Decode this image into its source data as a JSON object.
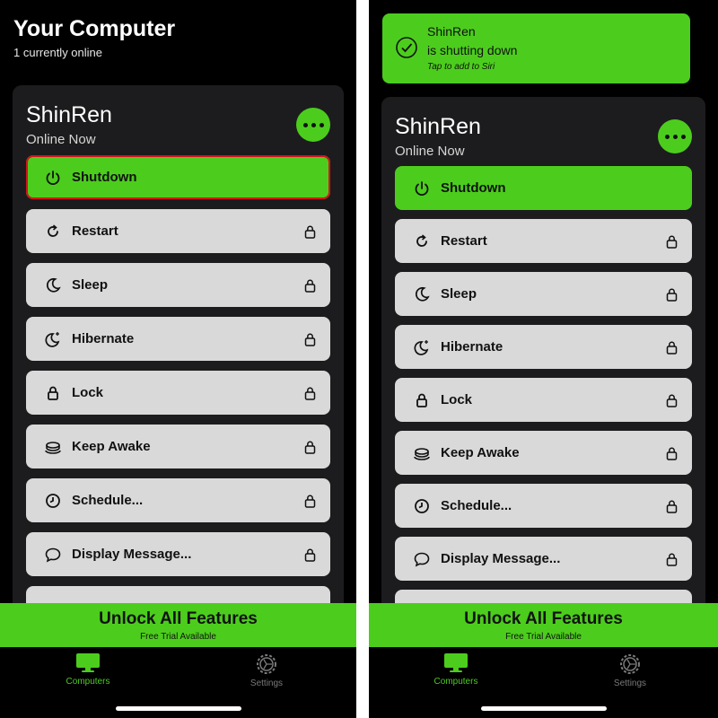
{
  "colors": {
    "accent": "#4ccd1d",
    "row_bg": "#d9d9d9",
    "card_bg": "#1c1c1e",
    "highlight_border": "#d4141a"
  },
  "left": {
    "title": "Your Computer",
    "subtitle": "1 currently online",
    "computer": {
      "name": "ShinRen",
      "status": "Online Now"
    },
    "actions": [
      {
        "label": "Shutdown",
        "icon": "power-icon",
        "locked": false,
        "primary": true,
        "highlighted": true
      },
      {
        "label": "Restart",
        "icon": "restart-icon",
        "locked": true
      },
      {
        "label": "Sleep",
        "icon": "moon-icon",
        "locked": true
      },
      {
        "label": "Hibernate",
        "icon": "moon-stars-icon",
        "locked": true
      },
      {
        "label": "Lock",
        "icon": "lock-icon",
        "locked": true
      },
      {
        "label": "Keep Awake",
        "icon": "coffee-cup-icon",
        "locked": true
      },
      {
        "label": "Schedule...",
        "icon": "clock-icon",
        "locked": true
      },
      {
        "label": "Display Message...",
        "icon": "speech-bubble-icon",
        "locked": true
      }
    ],
    "unlock": {
      "title": "Unlock All Features",
      "subtitle": "Free Trial Available"
    },
    "tabs": [
      {
        "label": "Computers",
        "icon": "monitor-icon",
        "active": true
      },
      {
        "label": "Settings",
        "icon": "gear-icon",
        "active": false
      }
    ]
  },
  "right": {
    "notification": {
      "title": "ShinRen",
      "body": "is shutting down",
      "hint": "Tap to add to Siri"
    },
    "computer": {
      "name": "ShinRen",
      "status": "Online Now"
    },
    "actions": [
      {
        "label": "Shutdown",
        "icon": "power-icon",
        "locked": false,
        "primary": true
      },
      {
        "label": "Restart",
        "icon": "restart-icon",
        "locked": true
      },
      {
        "label": "Sleep",
        "icon": "moon-icon",
        "locked": true
      },
      {
        "label": "Hibernate",
        "icon": "moon-stars-icon",
        "locked": true
      },
      {
        "label": "Lock",
        "icon": "lock-icon",
        "locked": true
      },
      {
        "label": "Keep Awake",
        "icon": "coffee-cup-icon",
        "locked": true
      },
      {
        "label": "Schedule...",
        "icon": "clock-icon",
        "locked": true
      },
      {
        "label": "Display Message...",
        "icon": "speech-bubble-icon",
        "locked": true
      }
    ],
    "unlock": {
      "title": "Unlock All Features",
      "subtitle": "Free Trial Available"
    },
    "tabs": [
      {
        "label": "Computers",
        "icon": "monitor-icon",
        "active": true
      },
      {
        "label": "Settings",
        "icon": "gear-icon",
        "active": false
      }
    ]
  }
}
